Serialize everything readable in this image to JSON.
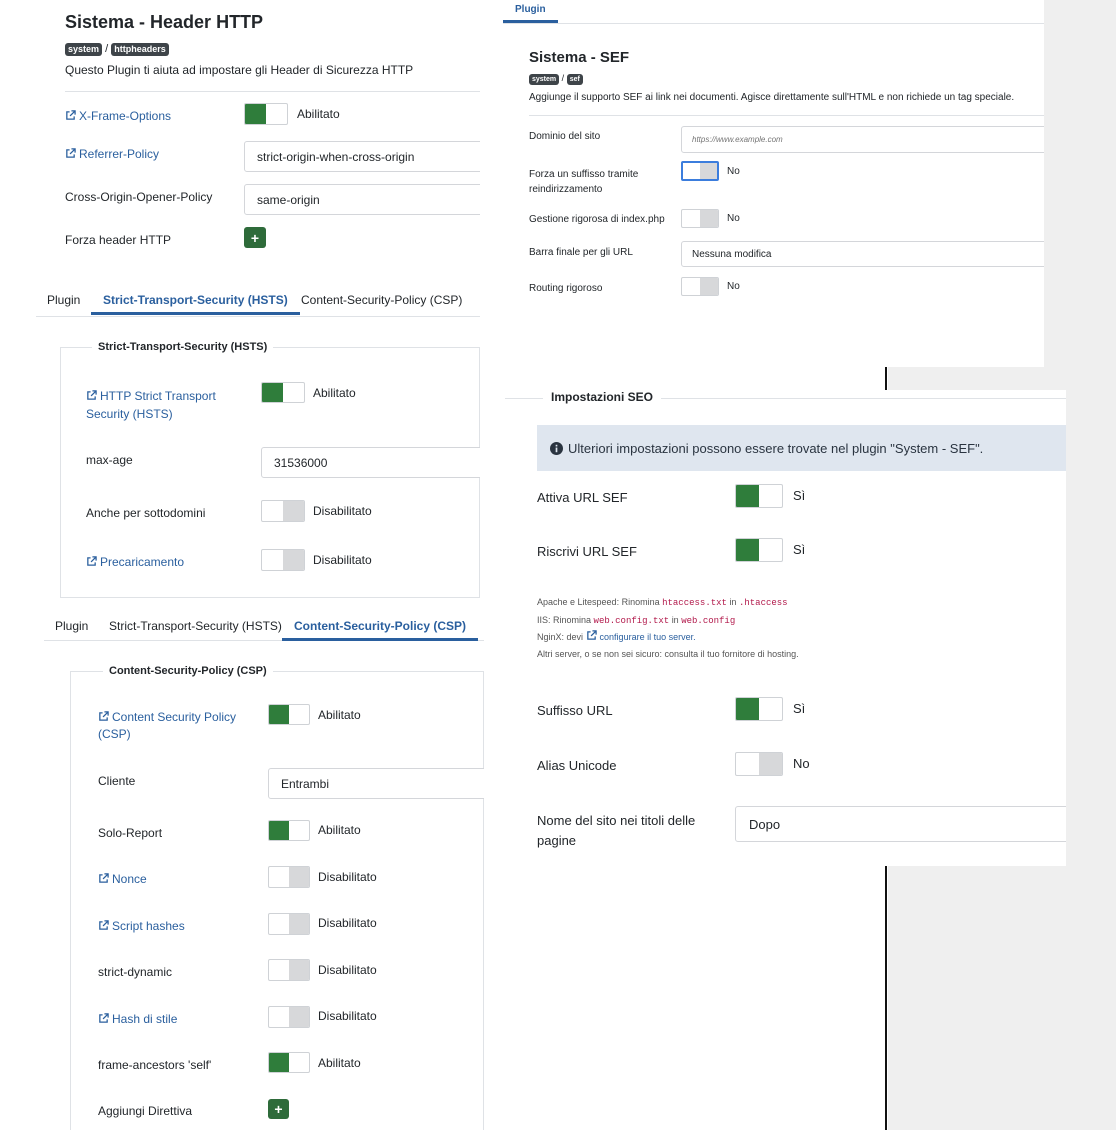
{
  "http_header": {
    "title": "Sistema - Header HTTP",
    "tag_system": "system",
    "tag_separator": "/",
    "tag_plugin": "httpheaders",
    "description": "Questo Plugin ti aiuta ad impostare gli Header di Sicurezza HTTP",
    "rows": {
      "xframe_label": "X-Frame-Options",
      "xframe_state": "Abilitato",
      "referrer_label": "Referrer-Policy",
      "referrer_value": "strict-origin-when-cross-origin",
      "coop_label": "Cross-Origin-Opener-Policy",
      "coop_value": "same-origin",
      "force_label": "Forza header HTTP",
      "force_button": "+"
    }
  },
  "hsts": {
    "tabs": [
      "Plugin",
      "Strict-Transport-Security (HSTS)",
      "Content-Security-Policy (CSP)"
    ],
    "legend": "Strict-Transport-Security (HSTS)",
    "rows": {
      "hsts_label": "HTTP Strict Transport Security (HSTS)",
      "hsts_state": "Abilitato",
      "maxage_label": "max-age",
      "maxage_value": "31536000",
      "subdomains_label": "Anche per sottodomini",
      "subdomains_state": "Disabilitato",
      "preload_label": "Precaricamento",
      "preload_state": "Disabilitato"
    }
  },
  "csp": {
    "tabs": [
      "Plugin",
      "Strict-Transport-Security (HSTS)",
      "Content-Security-Policy (CSP)"
    ],
    "legend": "Content-Security-Policy (CSP)",
    "rows": {
      "csp_label": "Content Security Policy (CSP)",
      "csp_state": "Abilitato",
      "client_label": "Cliente",
      "client_value": "Entrambi",
      "report_label": "Solo-Report",
      "report_state": "Abilitato",
      "nonce_label": "Nonce",
      "nonce_state": "Disabilitato",
      "script_label": "Script hashes",
      "script_state": "Disabilitato",
      "dynamic_label": "strict-dynamic",
      "dynamic_state": "Disabilitato",
      "style_label": "Hash di stile",
      "style_state": "Disabilitato",
      "ancestors_label": "frame-ancestors 'self'",
      "ancestors_state": "Abilitato",
      "directive_label": "Aggiungi Direttiva",
      "directive_button": "+"
    }
  },
  "sef": {
    "tab": "Plugin",
    "title": "Sistema - SEF",
    "tag_system": "system",
    "tag_separator": "/",
    "tag_plugin": "sef",
    "description": "Aggiunge il supporto SEF ai link nei documenti. Agisce direttamente sull'HTML e non richiede un tag speciale.",
    "rows": {
      "domain_label": "Dominio del sito",
      "domain_placeholder": "https://www.example.com",
      "suffix_label": "Forza un suffisso tramite reindirizzamento",
      "suffix_state": "No",
      "index_label": "Gestione rigorosa di index.php",
      "index_state": "No",
      "slash_label": "Barra finale per gli URL",
      "slash_value": "Nessuna modifica",
      "routing_label": "Routing rigoroso",
      "routing_state": "No"
    }
  },
  "seo": {
    "legend": "Impostazioni SEO",
    "info": "Ulteriori impostazioni possono essere trovate nel plugin \"System - SEF\".",
    "rows": {
      "sef_label": "Attiva URL SEF",
      "sef_state": "Sì",
      "rewrite_label": "Riscrivi URL SEF",
      "rewrite_state": "Sì",
      "suffix_label": "Suffisso URL",
      "suffix_state": "Sì",
      "unicode_label": "Alias Unicode",
      "unicode_state": "No",
      "sitename_label": "Nome del sito nei titoli delle pagine",
      "sitename_value": "Dopo"
    },
    "notes": {
      "apache_prefix": "Apache e Litespeed: Rinomina",
      "apache_from": "htaccess.txt",
      "apache_in": "in",
      "apache_to": ".htaccess",
      "iis_prefix": "IIS: Rinomina",
      "iis_from": "web.config.txt",
      "iis_in": "in",
      "iis_to": "web.config",
      "nginx_prefix": "NginX: devi",
      "nginx_link": "configurare il tuo server.",
      "other": "Altri server, o se non sei sicuro: consulta il tuo fornitore di hosting."
    }
  }
}
